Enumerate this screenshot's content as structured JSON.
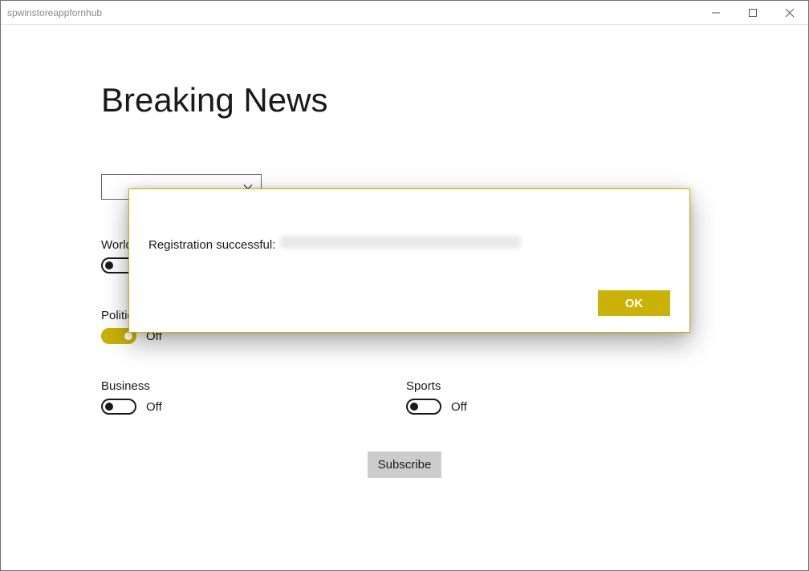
{
  "window": {
    "title": "spwinstoreappfornhub"
  },
  "page": {
    "title": "Breaking News",
    "dropdown_value": "",
    "subscribe_label": "Subscribe"
  },
  "toggles": [
    {
      "label": "World",
      "on": false,
      "state_text": "Off"
    },
    {
      "label": "",
      "on": false,
      "state_text": "Off"
    },
    {
      "label": "Politics",
      "on": true,
      "state_text": "Off"
    },
    {
      "label": "",
      "on": false,
      "state_text": "Off"
    },
    {
      "label": "Business",
      "on": false,
      "state_text": "Off"
    },
    {
      "label": "Sports",
      "on": false,
      "state_text": "Off"
    }
  ],
  "dialog": {
    "message": "Registration successful:",
    "ok_label": "OK"
  },
  "colors": {
    "accent": "#cab206"
  }
}
